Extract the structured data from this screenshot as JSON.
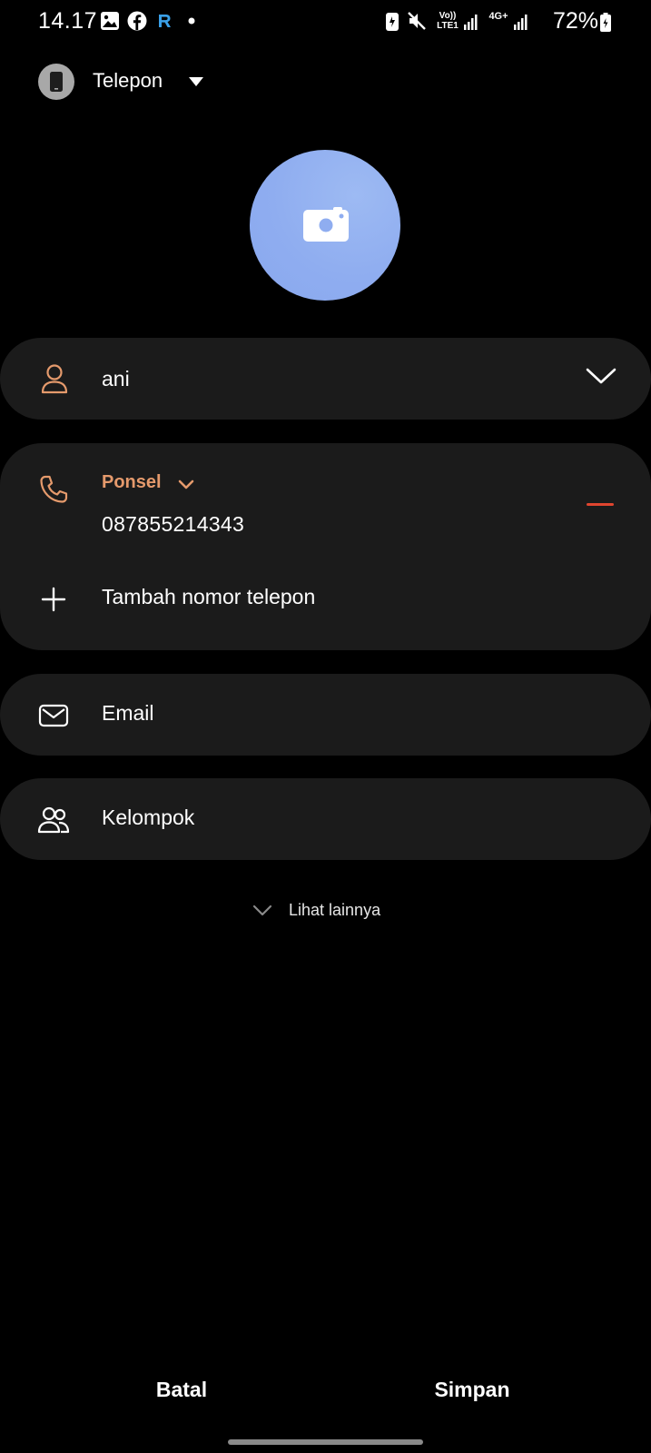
{
  "status_bar": {
    "time": "14.17",
    "network1": "Vo)) LTE1",
    "network2": "4G+",
    "battery": "72%"
  },
  "account": {
    "label": "Telepon"
  },
  "contact": {
    "name": "ani",
    "phone_type": "Ponsel",
    "phone_number": "087855214343",
    "add_phone_label": "Tambah nomor telepon",
    "email_label": "Email",
    "group_label": "Kelompok",
    "see_more_label": "Lihat lainnya"
  },
  "actions": {
    "cancel_label": "Batal",
    "save_label": "Simpan"
  },
  "colors": {
    "accent": "#e59a6c",
    "remove": "#e0452f",
    "photo": "#8fadf0",
    "card": "#1b1b1b"
  }
}
